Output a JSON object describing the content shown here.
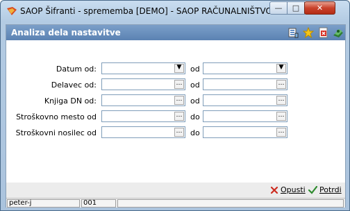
{
  "window": {
    "title": "SAOP Šifranti - sprememba [DEMO] - SAOP RAČUNALNIŠTVO"
  },
  "panel": {
    "title": "Analiza dela nastavitve"
  },
  "rows": [
    {
      "label": "Datum od:",
      "sep": "od",
      "type": "dropdown"
    },
    {
      "label": "Delavec od:",
      "sep": "od",
      "type": "lookup"
    },
    {
      "label": "Knjiga DN od:",
      "sep": "od",
      "type": "lookup"
    },
    {
      "label": "Stroškovno mesto od",
      "sep": "do",
      "type": "lookup"
    },
    {
      "label": "Stroškovni nosilec od",
      "sep": "do",
      "type": "lookup"
    }
  ],
  "actions": {
    "cancel": "Opusti",
    "confirm": "Potrdi"
  },
  "status": {
    "user": "peter-j",
    "code": "001"
  },
  "icons": {
    "header": [
      "properties-icon",
      "favorite-star-icon",
      "pdf-export-icon",
      "help-book-icon"
    ]
  },
  "colors": {
    "header_bg": "#5b82b3",
    "close_btn": "#c9422b",
    "cancel_icon": "#cc2b1f",
    "confirm_icon": "#2e8b2e"
  }
}
